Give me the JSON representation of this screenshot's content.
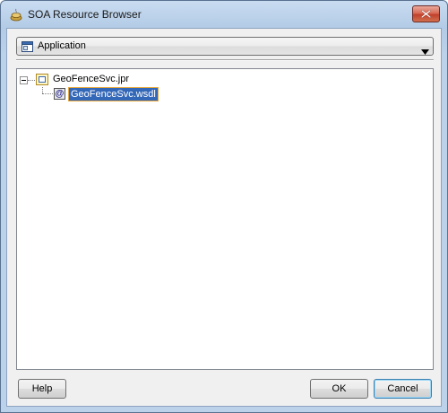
{
  "window": {
    "title": "SOA Resource Browser",
    "title_icon": "soa-resource-icon",
    "close_icon": "close-icon"
  },
  "selector": {
    "value": "Application",
    "icon": "application-icon"
  },
  "tree": {
    "project": {
      "label": "GeoFenceSvc.jpr",
      "icon": "project-folder-icon",
      "expanded": true
    },
    "file": {
      "label": "GeoFenceSvc.wsdl",
      "icon": "wsdl-icon",
      "icon_glyph": "@",
      "selected": true
    }
  },
  "buttons": {
    "help": "Help",
    "ok": "OK",
    "cancel": "Cancel"
  },
  "colors": {
    "selection": "#3367b8",
    "focus_border": "#e6a83d",
    "close_button": "#c0402c"
  }
}
